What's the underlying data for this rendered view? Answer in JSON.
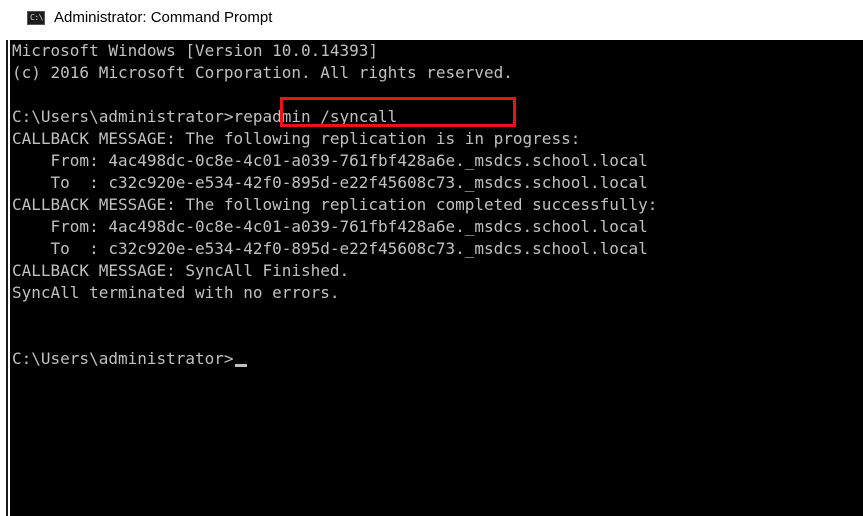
{
  "window": {
    "title": "Administrator: Command Prompt",
    "icon": "command-prompt-icon",
    "icon_glyph": "C:\\."
  },
  "console": {
    "background": "#000000",
    "text_color": "#c0c0c0",
    "highlight_color": "#e8141a",
    "lines": [
      "Microsoft Windows [Version 10.0.14393]",
      "(c) 2016 Microsoft Corporation. All rights reserved.",
      "",
      "C:\\Users\\administrator>repadmin /syncall",
      "CALLBACK MESSAGE: The following replication is in progress:",
      "    From: 4ac498dc-0c8e-4c01-a039-761fbf428a6e._msdcs.school.local",
      "    To  : c32c920e-e534-42f0-895d-e22f45608c73._msdcs.school.local",
      "CALLBACK MESSAGE: The following replication completed successfully:",
      "    From: 4ac498dc-0c8e-4c01-a039-761fbf428a6e._msdcs.school.local",
      "    To  : c32c920e-e534-42f0-895d-e22f45608c73._msdcs.school.local",
      "CALLBACK MESSAGE: SyncAll Finished.",
      "SyncAll terminated with no errors.",
      "",
      "",
      "C:\\Users\\administrator>"
    ],
    "highlighted_command": "repadmin /syncall"
  }
}
